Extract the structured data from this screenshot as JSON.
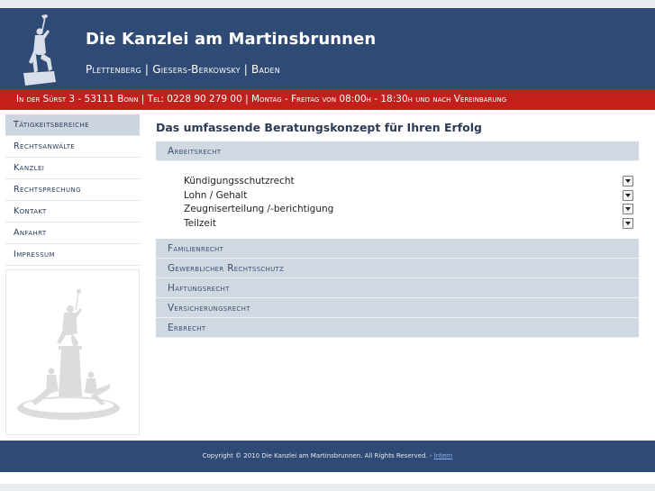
{
  "header": {
    "title": "Die Kanzlei am Martinsbrunnen",
    "subtitle": "Plettenberg | Giesers-Berkowsky | Baden"
  },
  "contact_bar": "In der Sürst 3 - 53111 Bonn | Tel: 0228 90 279 00 | Montag - Freitag von 08:00h - 18:30h und nach Vereinbarung",
  "sidebar": {
    "items": [
      {
        "label": "Tätigkeitsbereiche",
        "active": true
      },
      {
        "label": "Rechtsanwälte"
      },
      {
        "label": "Kanzlei"
      },
      {
        "label": "Rechtsprechung"
      },
      {
        "label": "Kontakt"
      },
      {
        "label": "Anfahrt"
      },
      {
        "label": "Impressum"
      }
    ]
  },
  "main": {
    "title": "Das umfassende Beratungskonzept für Ihren Erfolg",
    "sections": [
      {
        "label": "Arbeitsrecht",
        "expanded": true,
        "items": [
          "Kündigungsschutzrecht",
          "Lohn / Gehalt",
          "Zeugniserteilung /-berichtigung",
          "Teilzeit"
        ]
      },
      {
        "label": "Familienrecht"
      },
      {
        "label": "Gewerblicher Rechtsschutz"
      },
      {
        "label": "Haftungsrecht"
      },
      {
        "label": "Versicherungsrecht"
      },
      {
        "label": "Erbrecht"
      }
    ]
  },
  "footer": {
    "copyright": "Copyright © 2010 Die Kanzlei am Martinsbrunnen. All Rights Reserved. - ",
    "link": "Intern"
  },
  "colors": {
    "header_bg": "#2f4a74",
    "contact_bar_bg": "#c4201b",
    "section_bg": "#d0d9e2",
    "active_nav_bg": "#cdd6e0"
  },
  "icons": {
    "logo": "statue-icon",
    "sidebar_image": "fountain-statue-icon",
    "dropdown": "dropdown-arrow-icon"
  }
}
